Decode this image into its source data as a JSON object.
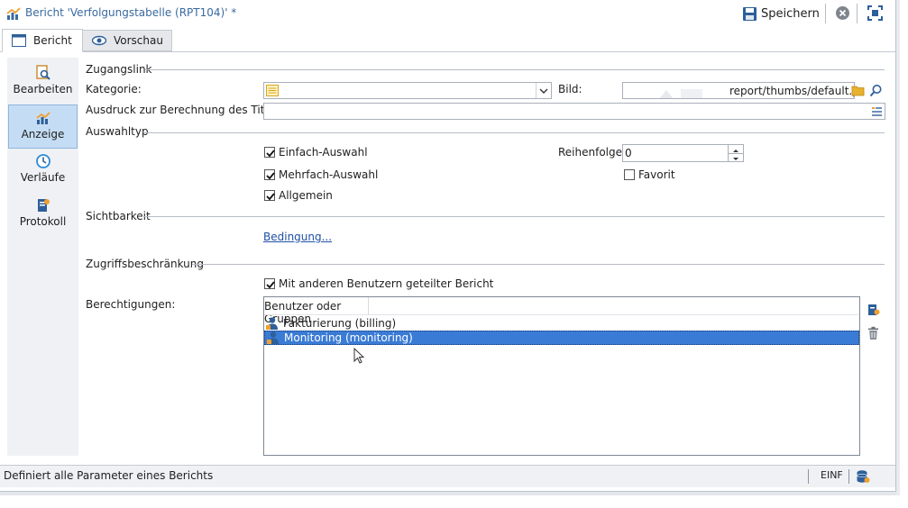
{
  "window": {
    "title": "Bericht 'Verfolgungstabelle (RPT104)' *",
    "save_label": "Speichern"
  },
  "tabs": [
    {
      "label": "Bericht",
      "icon": "form-icon"
    },
    {
      "label": "Vorschau",
      "icon": "eye-icon"
    }
  ],
  "sidebar": {
    "items": [
      {
        "label": "Bearbeiten",
        "icon": "edit-report-icon"
      },
      {
        "label": "Anzeige",
        "icon": "chart-icon",
        "selected": true
      },
      {
        "label": "Verläufe",
        "icon": "clock-icon"
      },
      {
        "label": "Protokoll",
        "icon": "log-icon"
      }
    ]
  },
  "form": {
    "section_access_link": "Zugangslink",
    "category_label": "Kategorie:",
    "category_value": "",
    "image_label": "Bild:",
    "image_value": "report/thumbs/default.png",
    "title_expr_label": "Ausdruck zur Berechnung des Titels:",
    "title_expr_value": "",
    "section_selection_type": "Auswahltyp",
    "single_select_label": "Einfach-Auswahl",
    "single_select_checked": true,
    "multi_select_label": "Mehrfach-Auswahl",
    "multi_select_checked": true,
    "general_label": "Allgemein",
    "general_checked": true,
    "order_label": "Reihenfolge:",
    "order_value": "0",
    "favorite_label": "Favorit",
    "favorite_checked": false,
    "section_visibility": "Sichtbarkeit",
    "condition_link": "Bedingung...",
    "section_access_restriction": "Zugriffsbeschränkung",
    "shared_label": "Mit anderen Benutzern geteilter Bericht",
    "shared_checked": true,
    "permissions_label": "Berechtigungen:",
    "list_header": "Benutzer oder Gruppen",
    "permissions": [
      {
        "label": "Fakturierung (billing)",
        "icon": "operator-icon",
        "selected": false
      },
      {
        "label": "Monitoring (monitoring)",
        "icon": "operator-icon",
        "selected": true
      }
    ]
  },
  "status": {
    "message": "Definiert alle Parameter eines Berichts",
    "mode": "EINF"
  },
  "colors": {
    "accent": "#3a7bd5",
    "title": "#3a6aa0",
    "sidebar_selected": "#c5ddf4"
  }
}
